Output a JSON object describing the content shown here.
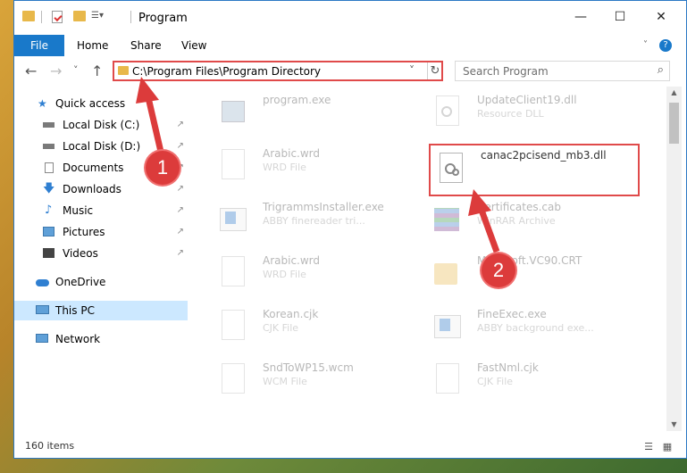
{
  "window": {
    "title": "Program",
    "minimize_icon": "—",
    "maximize_icon": "☐",
    "close_icon": "✕",
    "help_icon": "?"
  },
  "ribbon": {
    "tabs": [
      "File",
      "Home",
      "Share",
      "View"
    ]
  },
  "address": {
    "back_icon": "←",
    "forward_icon": "→",
    "recent_icon": "˅",
    "up_icon": "↑",
    "path": "C:\\Program Files\\Program Directory",
    "dropdown_icon": "˅",
    "refresh_icon": "↻"
  },
  "search": {
    "placeholder": "Search Program",
    "icon": "⌕"
  },
  "nav": {
    "items": [
      {
        "label": "Quick access",
        "icon": "star-icon",
        "pinned": false
      },
      {
        "label": "Local Disk (C:)",
        "icon": "drive-icon",
        "pinned": true
      },
      {
        "label": "Local Disk (D:)",
        "icon": "drive-icon",
        "pinned": true
      },
      {
        "label": "Documents",
        "icon": "documents-icon",
        "pinned": true
      },
      {
        "label": "Downloads",
        "icon": "download-icon",
        "pinned": true
      },
      {
        "label": "Music",
        "icon": "music-icon",
        "pinned": true
      },
      {
        "label": "Pictures",
        "icon": "pictures-icon",
        "pinned": true
      },
      {
        "label": "Videos",
        "icon": "videos-icon",
        "pinned": true
      },
      {
        "label": "OneDrive",
        "icon": "cloud-icon",
        "pinned": false
      },
      {
        "label": "This PC",
        "icon": "computer-icon",
        "pinned": false,
        "selected": true
      },
      {
        "label": "Network",
        "icon": "network-icon",
        "pinned": false
      }
    ],
    "pin_icon": "↗"
  },
  "files": {
    "left": [
      {
        "name": "program.exe",
        "type": ""
      },
      {
        "name": "Arabic.wrd",
        "type": "WRD File"
      },
      {
        "name": "TrigrammsInstaller.exe",
        "type": "ABBY finereader tri..."
      },
      {
        "name": "Arabic.wrd",
        "type": "WRD File"
      },
      {
        "name": "Korean.cjk",
        "type": "CJK File"
      },
      {
        "name": "SndToWP15.wcm",
        "type": "WCM File"
      }
    ],
    "right": [
      {
        "name": "UpdateClient19.dll",
        "type": "Resource DLL"
      },
      {
        "name": "canac2pcisend_mb3.dll",
        "type": ""
      },
      {
        "name": "Certificates.cab",
        "type": "WinRAR Archive"
      },
      {
        "name": "Microsoft.VC90.CRT",
        "type": ""
      },
      {
        "name": "FineExec.exe",
        "type": "ABBY background exe..."
      },
      {
        "name": "FastNml.cjk",
        "type": "CJK File"
      }
    ]
  },
  "status": {
    "item_count": "160 items"
  },
  "callouts": [
    "1",
    "2"
  ],
  "colors": {
    "accent": "#1979ca",
    "highlight_red": "#e04a4a",
    "selected_nav": "#cce8ff"
  }
}
